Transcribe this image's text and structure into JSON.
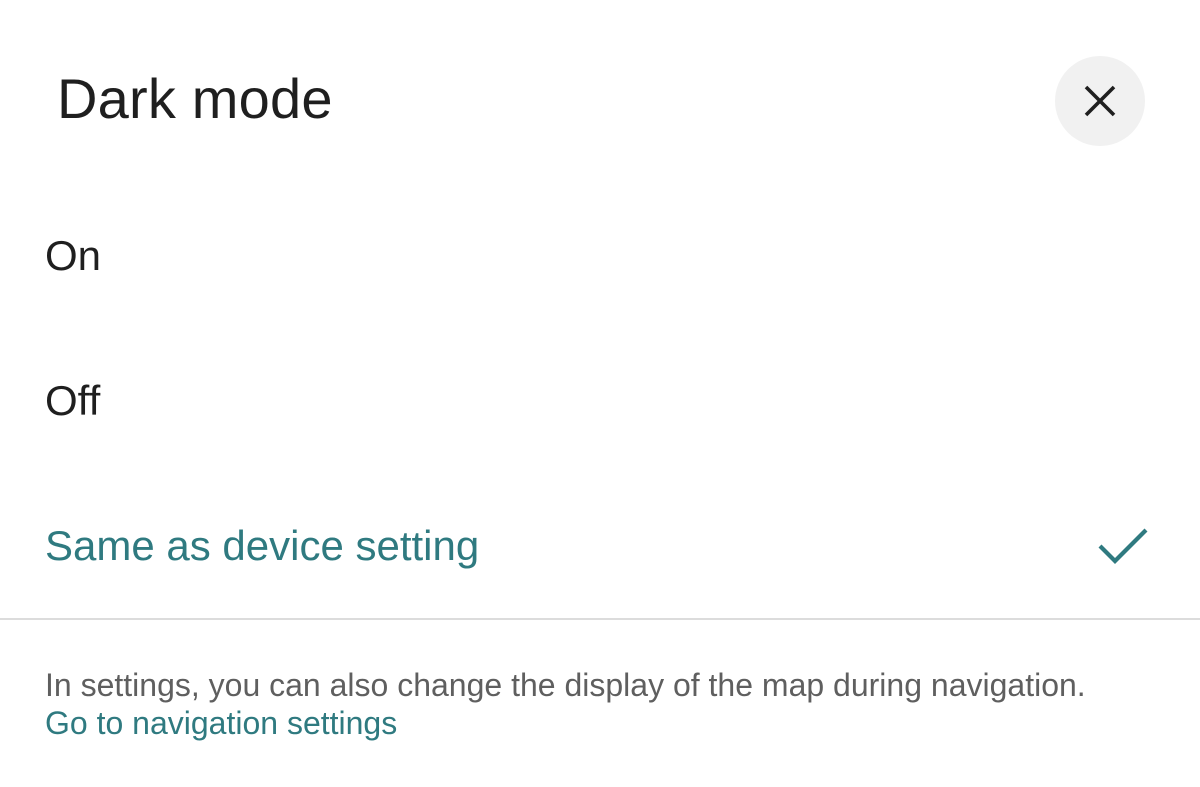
{
  "dialog": {
    "title": "Dark mode",
    "close_icon": "close-icon",
    "options": [
      {
        "label": "On",
        "selected": false
      },
      {
        "label": "Off",
        "selected": false
      },
      {
        "label": "Same as device setting",
        "selected": true,
        "icon": "checkmark-icon"
      }
    ],
    "footer": {
      "text": "In settings, you can also change the display of the map during navigation.",
      "link_label": "Go to navigation settings"
    }
  },
  "colors": {
    "accent": "#2f7a80",
    "text": "#1f1f1f",
    "secondary_text": "#5f5f5f",
    "close_button_bg": "#f1f1f1",
    "divider": "#dcdcdc"
  }
}
